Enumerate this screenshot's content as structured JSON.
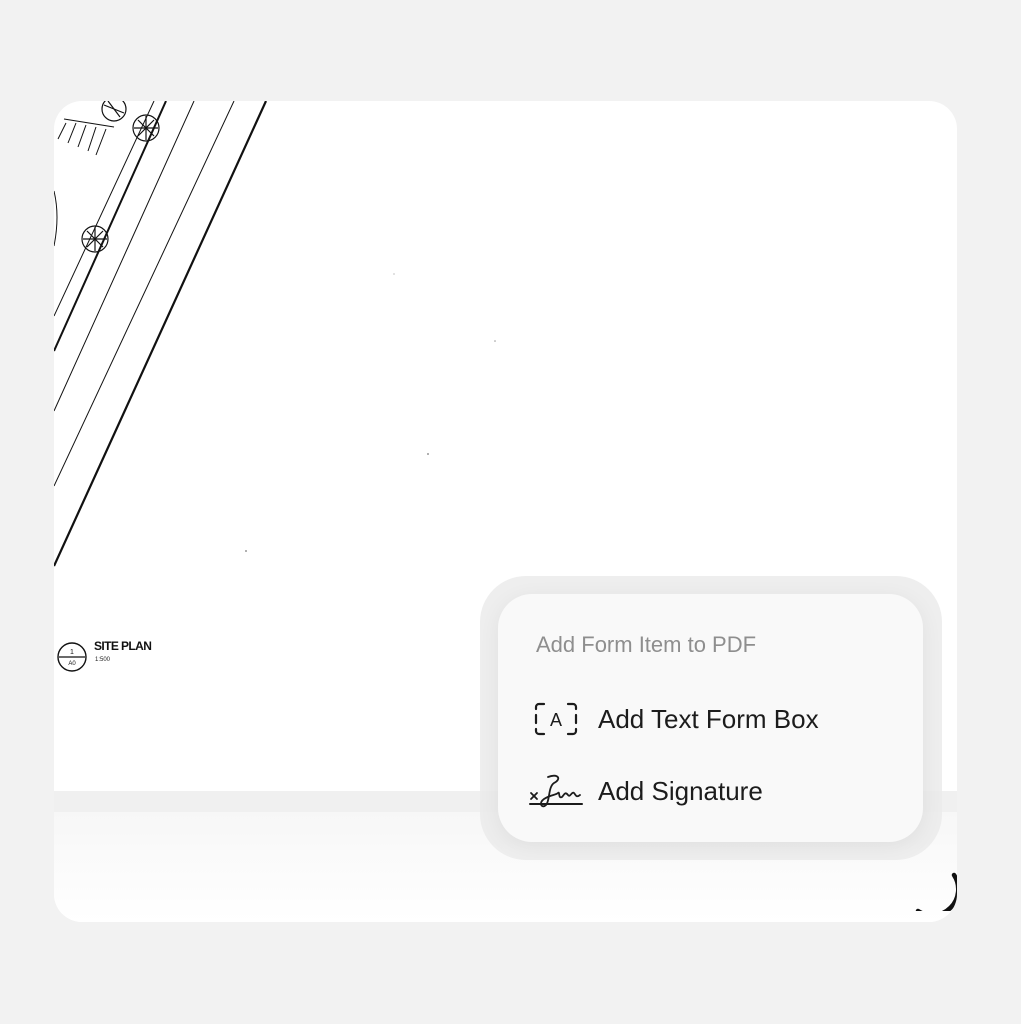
{
  "document": {
    "site_plan": {
      "marker_number": "1",
      "marker_sheet": "A0",
      "title": "SITE PLAN",
      "scale": "1:500"
    }
  },
  "form_menu": {
    "title": "Add Form Item to PDF",
    "items": [
      {
        "label": "Add Text Form Box",
        "icon": "text-box-icon",
        "icon_glyph": "A"
      },
      {
        "label": "Add Signature",
        "icon": "signature-icon"
      }
    ]
  },
  "colors": {
    "background": "#f2f2f2",
    "menu_background": "#f9f9f9",
    "menu_title": "#8e8e8e",
    "menu_item_text": "#1c1c1c"
  }
}
